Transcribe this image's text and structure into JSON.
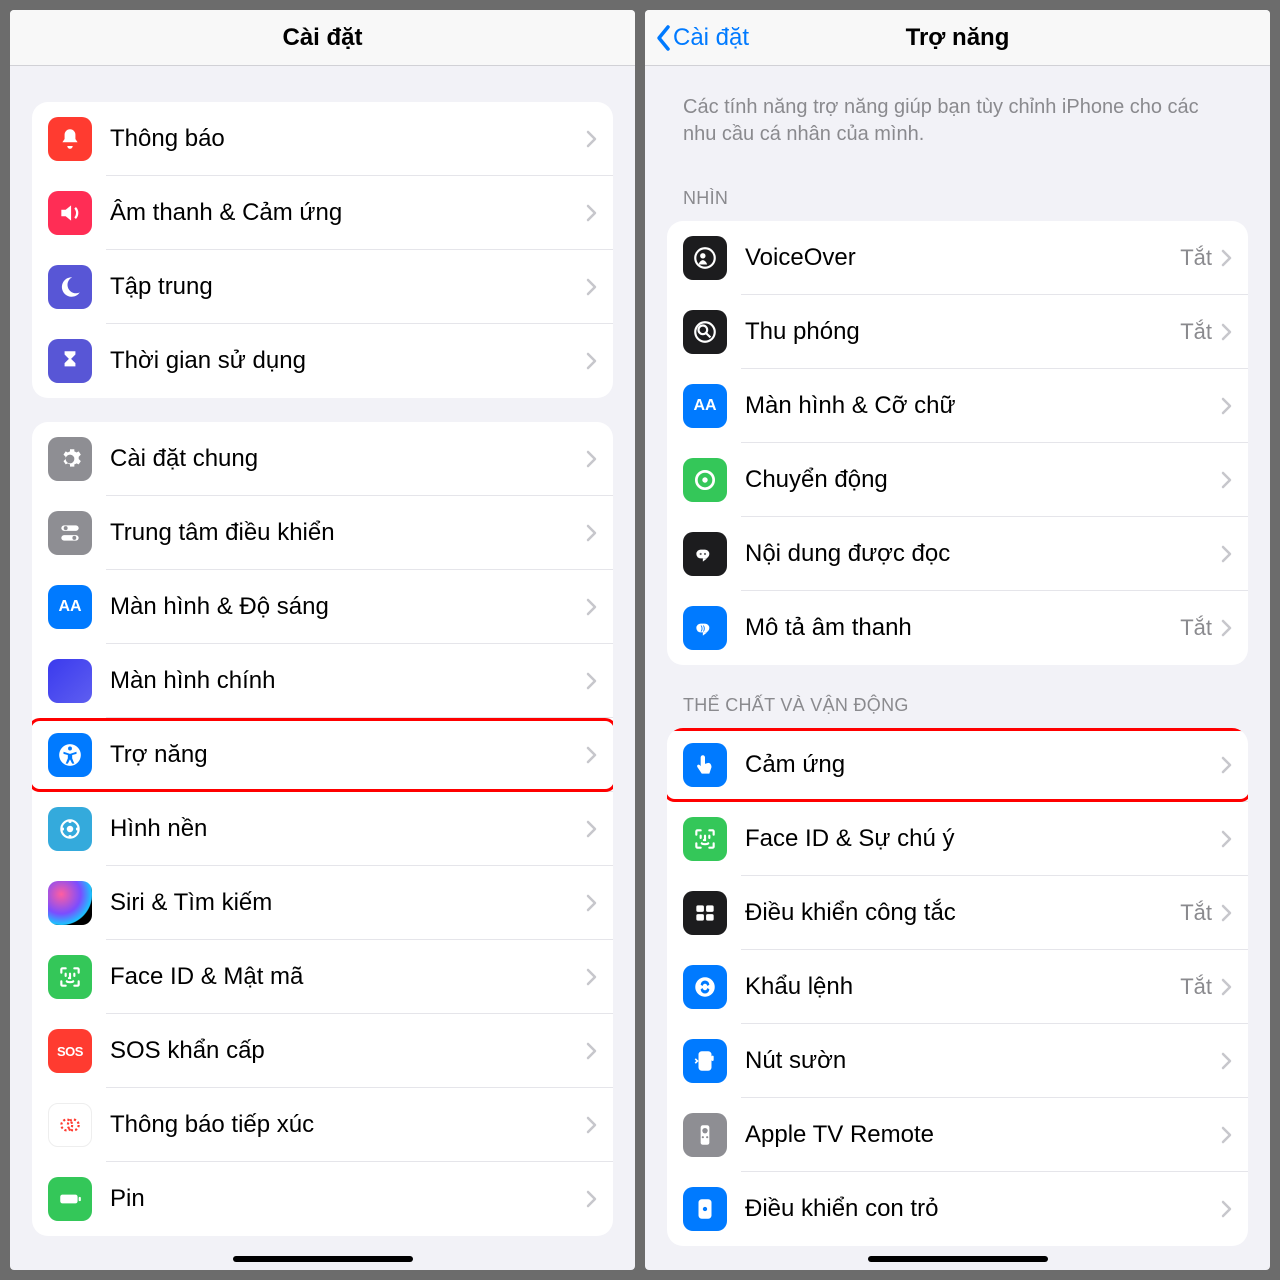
{
  "left": {
    "title": "Cài đặt",
    "groups": [
      {
        "items": [
          {
            "label": "Thông báo",
            "icon": "bell-icon",
            "color": "bg-red"
          },
          {
            "label": "Âm thanh & Cảm ứng",
            "icon": "sound-icon",
            "color": "bg-pink"
          },
          {
            "label": "Tập trung",
            "icon": "moon-icon",
            "color": "bg-purple"
          },
          {
            "label": "Thời gian sử dụng",
            "icon": "hourglass-icon",
            "color": "bg-purple"
          }
        ]
      },
      {
        "items": [
          {
            "label": "Cài đặt chung",
            "icon": "gear-icon",
            "color": "bg-gray"
          },
          {
            "label": "Trung tâm điều khiển",
            "icon": "toggles-icon",
            "color": "bg-gray"
          },
          {
            "label": "Màn hình & Độ sáng",
            "icon": "aa-icon",
            "color": "bg-blue"
          },
          {
            "label": "Màn hình chính",
            "icon": "homegrid-icon",
            "color": "icon-grid"
          },
          {
            "label": "Trợ năng",
            "icon": "accessibility-icon",
            "color": "bg-blue",
            "highlight": true
          },
          {
            "label": "Hình nền",
            "icon": "wallpaper-icon",
            "color": "bg-lightblue"
          },
          {
            "label": "Siri & Tìm kiếm",
            "icon": "siri-icon",
            "color": "siri"
          },
          {
            "label": "Face ID & Mật mã",
            "icon": "faceid-icon",
            "color": "bg-green"
          },
          {
            "label": "SOS khẩn cấp",
            "icon": "sos-icon",
            "color": "bg-red"
          },
          {
            "label": "Thông báo tiếp xúc",
            "icon": "exposure-icon",
            "color": "bg-white"
          },
          {
            "label": "Pin",
            "icon": "battery-icon",
            "color": "bg-green"
          }
        ]
      }
    ]
  },
  "right": {
    "back": "Cài đặt",
    "title": "Trợ năng",
    "intro": "Các tính năng trợ năng giúp bạn tùy chỉnh iPhone cho các nhu cầu cá nhân của mình.",
    "sections": [
      {
        "header": "NHÌN",
        "items": [
          {
            "label": "VoiceOver",
            "value": "Tắt",
            "icon": "voiceover-icon",
            "color": "bg-black"
          },
          {
            "label": "Thu phóng",
            "value": "Tắt",
            "icon": "zoom-icon",
            "color": "bg-black"
          },
          {
            "label": "Màn hình & Cỡ chữ",
            "icon": "aa-icon",
            "color": "bg-blue"
          },
          {
            "label": "Chuyển động",
            "icon": "motion-icon",
            "color": "bg-green"
          },
          {
            "label": "Nội dung được đọc",
            "icon": "speak-icon",
            "color": "bg-black"
          },
          {
            "label": "Mô tả âm thanh",
            "value": "Tắt",
            "icon": "audiodesc-icon",
            "color": "bg-blue"
          }
        ]
      },
      {
        "header": "THỂ CHẤT VÀ VẬN ĐỘNG",
        "items": [
          {
            "label": "Cảm ứng",
            "icon": "touch-icon",
            "color": "bg-blue",
            "highlight": true
          },
          {
            "label": "Face ID & Sự chú ý",
            "icon": "faceid-icon",
            "color": "bg-green"
          },
          {
            "label": "Điều khiển công tắc",
            "value": "Tắt",
            "icon": "switch-icon",
            "color": "bg-black"
          },
          {
            "label": "Khẩu lệnh",
            "value": "Tắt",
            "icon": "voicecontrol-icon",
            "color": "bg-blue"
          },
          {
            "label": "Nút sườn",
            "icon": "sidebutton-icon",
            "color": "bg-blue"
          },
          {
            "label": "Apple TV Remote",
            "icon": "remote-icon",
            "color": "bg-gray"
          },
          {
            "label": "Điều khiển con trỏ",
            "icon": "pointer-icon",
            "color": "bg-blue"
          }
        ]
      }
    ]
  }
}
